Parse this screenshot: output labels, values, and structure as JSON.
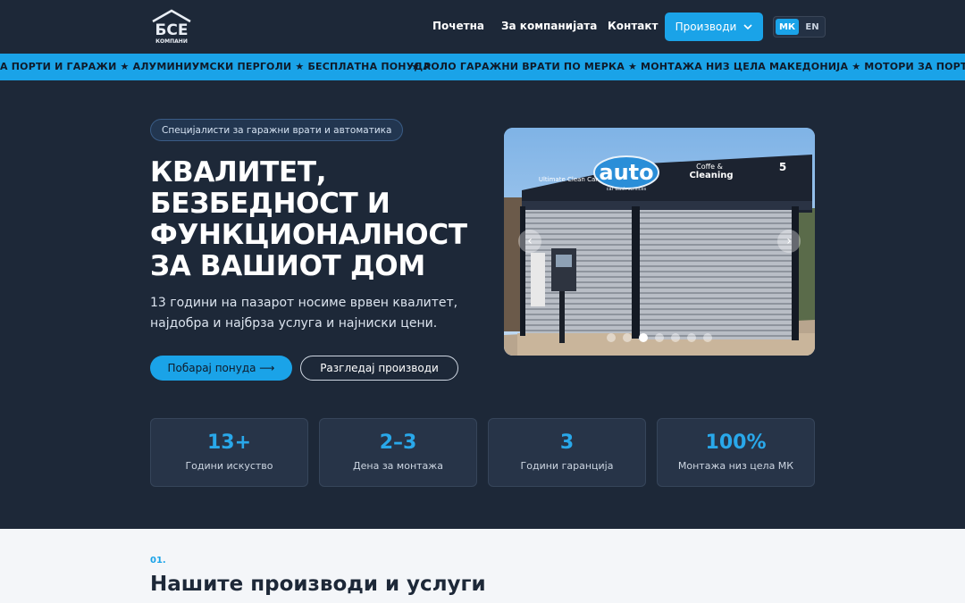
{
  "header": {
    "logo_text": "БСЕ",
    "logo_subtext": "КОМПАНИ",
    "nav": {
      "home": "Почетна",
      "about": "За компанијата",
      "contact": "Контакт",
      "products": "Производи"
    },
    "languages": {
      "mk": "МК",
      "en": "EN",
      "active": "МК"
    }
  },
  "marquee": {
    "segment_left": "А ПОРТИ И ГАРАЖИ ★ АЛУМИНИУМСКИ ПЕРГОЛИ ★ БЕСПЛАТНА ПОНУДА",
    "segment_right": "★ РОЛО ГАРАЖНИ ВРАТИ ПО МЕРКА ★ МОНТАЖА НИЗ ЦЕЛА МАКЕДОНИЈА ★ МОТОРИ ЗА ПОРТИ И ГАРАЖ"
  },
  "hero": {
    "badge": "Специјалисти за гаражни врати и автоматика",
    "title": "КВАЛИТЕТ, БЕЗБЕДНОСТ И ФУНКЦИОНАЛНОСТ ЗА ВАШИОТ ДОМ",
    "subtitle": "13 години на пазарот носиме врвен квалитет, најдобра и најбрза услуга и најниски цени.",
    "cta_primary": "Побарај понуда ⟶",
    "cta_secondary": "Разгледај производи"
  },
  "slider": {
    "slide_count": 7,
    "active_index": 2,
    "image_texts": {
      "brand": "auto",
      "brand_sub": "car wash services",
      "left_sign": "Ultimate Clean Car",
      "right_sign_top": "Coffe &",
      "right_sign_bottom": "Cleaning",
      "timer": "5"
    }
  },
  "stats": [
    {
      "value": "13+",
      "label": "Години искуство"
    },
    {
      "value": "2–3",
      "label": "Дена за монтажа"
    },
    {
      "value": "3",
      "label": "Години гаранција"
    },
    {
      "value": "100%",
      "label": "Монтажа низ цела МК"
    }
  ],
  "products_section": {
    "number": "01.",
    "title": "Нашите производи и услуги"
  },
  "colors": {
    "background": "#1d2838",
    "accent": "#1aa3e8",
    "card": "#273448",
    "section_bg": "#f4f6f9"
  }
}
